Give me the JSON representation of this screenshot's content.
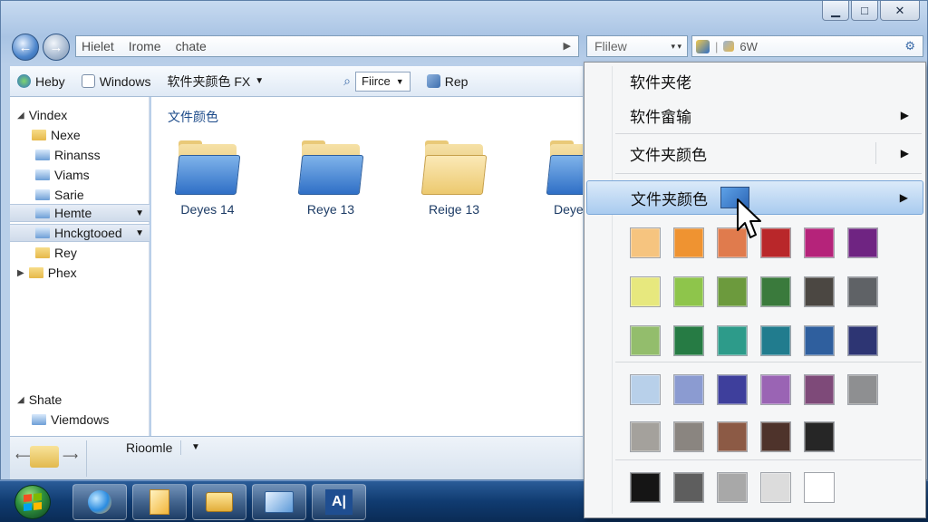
{
  "window": {
    "minimize": "▁",
    "maximize": "□",
    "close": "✕"
  },
  "address": {
    "parts": [
      "Hielet",
      "Irome",
      "chate"
    ],
    "search_value": "Flilew",
    "right_label": "6W"
  },
  "cmdbar": {
    "item1": "Heby",
    "item2": "Windows",
    "item3": "软件夹颜色 FX",
    "view": "Fiirce",
    "item5": "Rep"
  },
  "navpane": {
    "items": [
      {
        "label": "Vindex",
        "type": "header"
      },
      {
        "label": "Nexe",
        "type": "folder"
      },
      {
        "label": "Rinanss",
        "type": "folder-blue"
      },
      {
        "label": "Viams",
        "type": "folder-blue"
      },
      {
        "label": "Sarie",
        "type": "folder-blue"
      },
      {
        "label": "Hemte",
        "type": "selected"
      },
      {
        "label": "Hnckgtooed",
        "type": "selected"
      },
      {
        "label": "Rey",
        "type": "folder"
      },
      {
        "label": "Phex",
        "type": "folder-header"
      }
    ],
    "bottom_header": "Shate",
    "bottom_item": "Viemdows"
  },
  "content": {
    "title": "文件颜色",
    "folders": [
      {
        "label": "Deyes 14",
        "style": "blue"
      },
      {
        "label": "Reye 13",
        "style": "blue"
      },
      {
        "label": "Reige 13",
        "style": "pale"
      },
      {
        "label": "Deye",
        "style": "blue"
      }
    ]
  },
  "details": {
    "label": "Rioomle"
  },
  "menu": {
    "items": [
      {
        "label": "软件夹佬",
        "submenu": false
      },
      {
        "label": "软件畲输",
        "submenu": true
      },
      {
        "label": "文件夹颜色",
        "submenu": true
      },
      {
        "label": "文件夹颜色",
        "submenu": true,
        "highlighted": true
      }
    ],
    "swatch_rows": [
      [
        "#f6c47f",
        "#ef9331",
        "#e07b4d",
        "#b9272a",
        "#b5237a",
        "#6f2482"
      ],
      [
        "#e7e87e",
        "#8ec54b",
        "#6c9a3d",
        "#3a7a3c",
        "#4b4742",
        "#5f6266"
      ],
      [
        "#93bd6c",
        "#267b44",
        "#2d9b8a",
        "#217c8e",
        "#2f5f9e",
        "#2d3573"
      ],
      [
        "#b8d0ea",
        "#8b9bd1",
        "#3e3f9c",
        "#9a64b4",
        "#7e4a79",
        "#8e8f91"
      ],
      [
        "#a4a19c",
        "#8a8580",
        "#8c5a45",
        "#4e332b",
        "#262626"
      ],
      [
        "#151515",
        "#5e5e5e",
        "#a8a8a8",
        "#dcdcdc",
        "#ffffff"
      ]
    ]
  },
  "colors": {
    "accent": "#2f6fc6",
    "taskbar": "#103b70",
    "highlight": "#a9cbef"
  }
}
